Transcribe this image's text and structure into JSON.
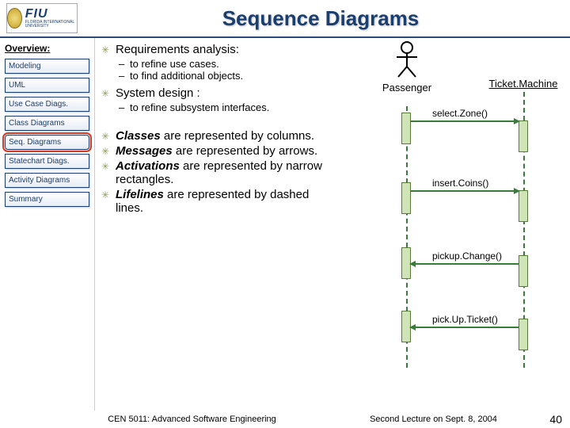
{
  "header": {
    "title": "Sequence Diagrams",
    "logo_big": "FIU",
    "logo_small": "FLORIDA INTERNATIONAL UNIVERSITY"
  },
  "sidebar": {
    "heading": "Overview:",
    "items": [
      "Modeling",
      "UML",
      "Use Case Diags.",
      "Class Diagrams",
      "Seq. Diagrams",
      "Statechart Diags.",
      "Activity Diagrams",
      "Summary"
    ],
    "active_index": 4
  },
  "content": {
    "b1": "Requirements analysis:",
    "b1s1": "to refine use cases.",
    "b1s2": "to find additional objects.",
    "b2": "System design :",
    "b2s1": "to refine subsystem interfaces.",
    "b3a": "Classes",
    "b3b": " are represented by columns.",
    "b4a": "Messages",
    "b4b": " are represented by arrows.",
    "b5a": "Activations",
    "b5b": " are represented by narrow rectangles.",
    "b6a": "Lifelines",
    "b6b": " are represented by dashed lines."
  },
  "diagram": {
    "actor": "Passenger",
    "object": "Ticket.Machine",
    "messages": [
      "select.Zone()",
      "insert.Coins()",
      "pickup.Change()",
      "pick.Up.Ticket()"
    ]
  },
  "footer": {
    "course": "CEN 5011: Advanced Software Engineering",
    "date": "Second Lecture on Sept. 8, 2004",
    "page": "40"
  }
}
